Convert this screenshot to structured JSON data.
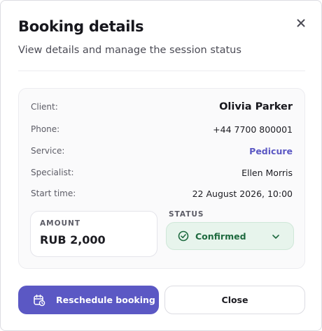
{
  "dialog": {
    "title": "Booking details",
    "subtitle": "View details and manage the session status"
  },
  "details": [
    {
      "label": "Client:",
      "value": "Olivia Parker"
    },
    {
      "label": "Phone:",
      "value": "+44 7700 800001"
    },
    {
      "label": "Service:",
      "value": "Pedicure"
    },
    {
      "label": "Specialist:",
      "value": "Ellen Morris"
    },
    {
      "label": "Start time:",
      "value": "22 August 2026, 10:00"
    }
  ],
  "amount": {
    "label": "AMOUNT",
    "value": "RUB 2,000"
  },
  "status": {
    "label": "STATUS",
    "selected": "Confirmed",
    "icon": "check-circle-icon"
  },
  "buttons": {
    "reschedule": "Reschedule booking",
    "close": "Close"
  },
  "colors": {
    "accent": "#5b58c4",
    "status_bg": "#e7f4ec",
    "status_text": "#1e6a3f"
  }
}
